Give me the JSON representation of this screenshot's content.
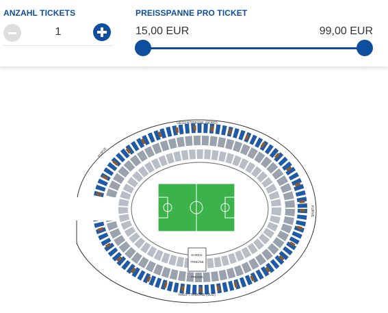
{
  "filters": {
    "tickets_label": "ANZAHL TICKETS",
    "quantity": "1",
    "price_label": "PREISSPANNE PRO TICKET",
    "price_min": "15,00 EUR",
    "price_max": "99,00 EUR",
    "accent_color": "#0d4f9e"
  },
  "stadium": {
    "north_label": "GEGENTRIBÜNE (NORD)",
    "south_label": "HAUPTTRIBÜNE (SÜD)",
    "east_label": "KURVE",
    "west_label": "KURVE",
    "ehren_label": "EHREN-",
    "tribuene_label": "TRIBÜNE",
    "presse_label": "PRESSE"
  }
}
